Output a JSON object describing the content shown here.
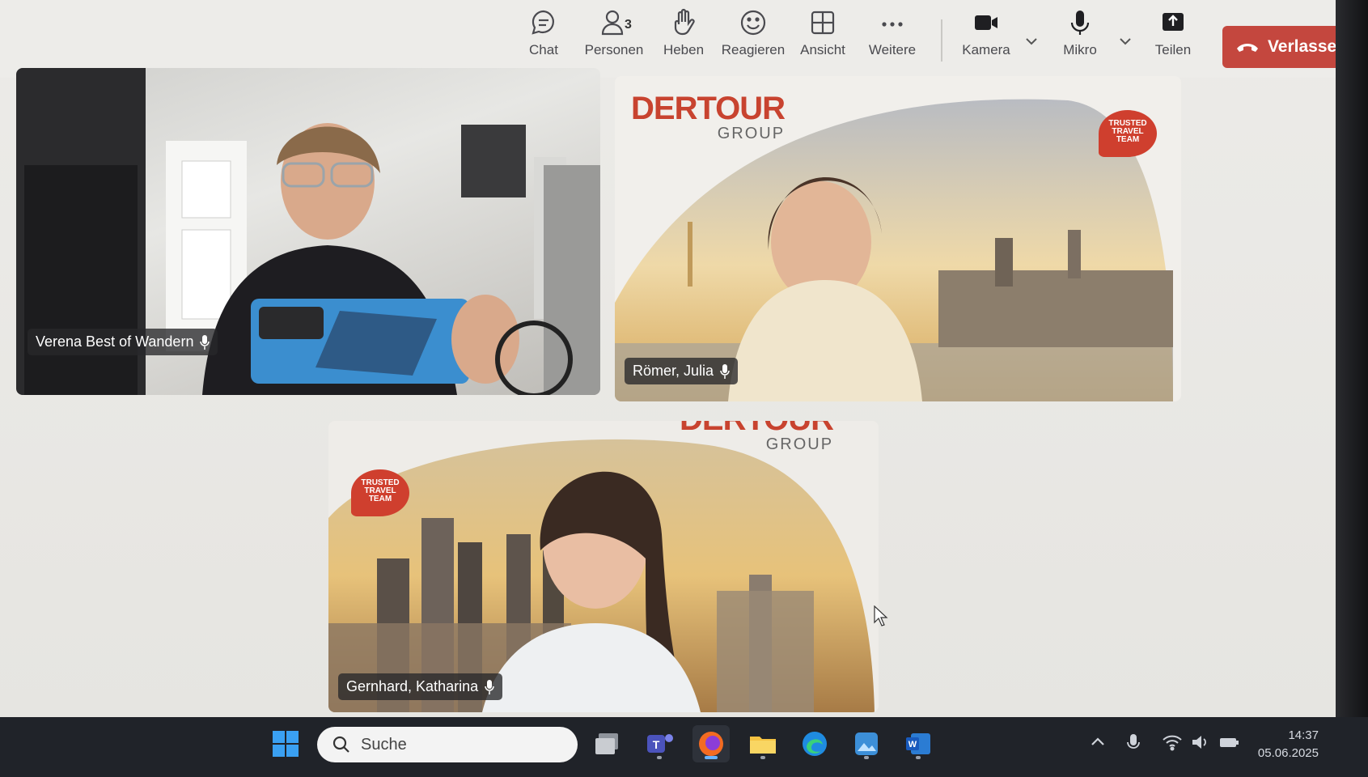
{
  "toolbar": {
    "chat_label": "Chat",
    "people_label": "Personen",
    "people_count": "3",
    "raise_label": "Heben",
    "react_label": "Reagieren",
    "view_label": "Ansicht",
    "more_label": "Weitere",
    "camera_label": "Kamera",
    "mic_label": "Mikro",
    "share_label": "Teilen",
    "leave_label": "Verlassen"
  },
  "participants": [
    {
      "name": "Verena Best of Wandern"
    },
    {
      "name": "Römer, Julia"
    },
    {
      "name": "Gernhard, Katharina"
    }
  ],
  "brand": {
    "name": "DERTOUR",
    "sub": "GROUP",
    "badge_line1": "TRUSTED",
    "badge_line2": "TRAVEL",
    "badge_line3": "TEAM"
  },
  "taskbar": {
    "search_placeholder": "Suche",
    "time": "14:37",
    "date": "05.06.2025"
  },
  "colors": {
    "leave": "#c4473e",
    "brand_red": "#c8432f",
    "taskbar": "#202329"
  }
}
